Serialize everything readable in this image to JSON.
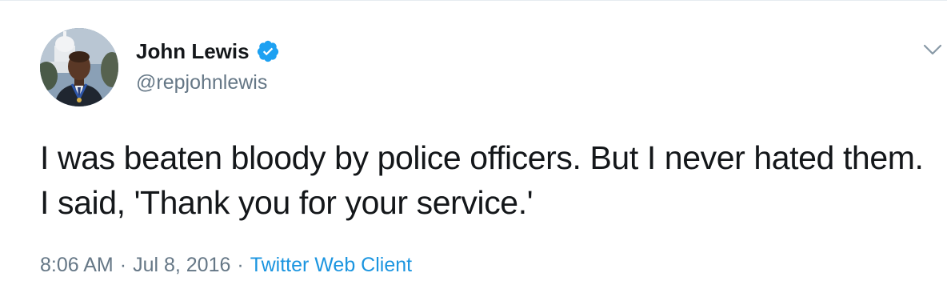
{
  "author": {
    "display_name": "John Lewis",
    "handle": "@repjohnlewis",
    "verified": true,
    "verified_icon": "verified-badge-icon",
    "avatar_icon": "profile-photo"
  },
  "tweet": {
    "text": "I was beaten bloody by police officers. But I never hated them. I said, 'Thank you for your service.'"
  },
  "meta": {
    "time": "8:06 AM",
    "separator": "·",
    "date": "Jul 8, 2016",
    "source": "Twitter Web Client"
  },
  "menu": {
    "icon": "chevron-down-icon"
  },
  "colors": {
    "verified_blue": "#1da1f2",
    "link_blue": "#1b95e0",
    "secondary_text": "#657786",
    "primary_text": "#14171a",
    "divider": "#e6ecf0"
  }
}
